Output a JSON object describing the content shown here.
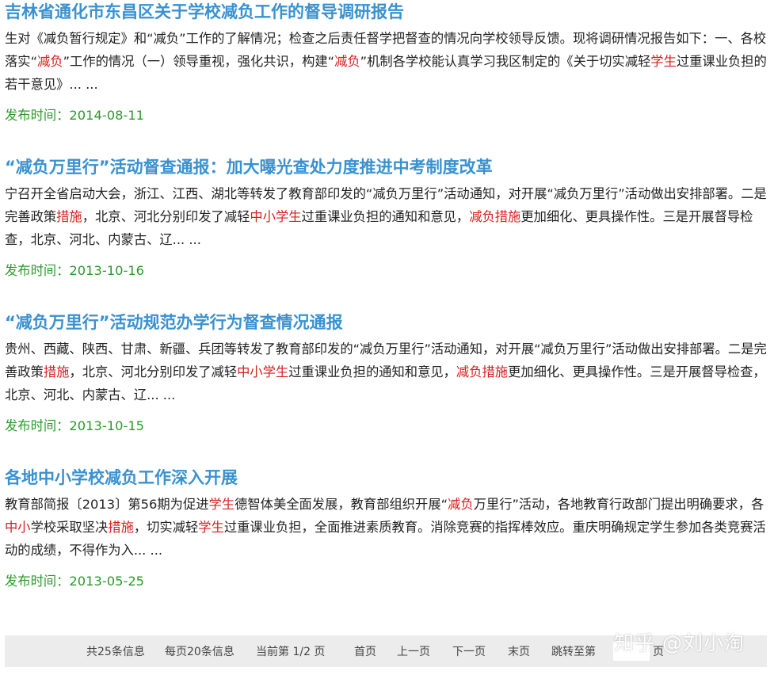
{
  "results": [
    {
      "title": "吉林省通化市东昌区关于学校减负工作的督导调研报告",
      "snippet": [
        {
          "t": "生对《减负暂行规定》和“减负”工作的了解情况；检查之后责任督学把督查的情况向学校领导反馈。现将调研情况报告如下：一、各校落实“"
        },
        {
          "t": "减负",
          "hl": true
        },
        {
          "t": "”工作的情况（一）领导重视，强化共识，构建“"
        },
        {
          "t": "减负",
          "hl": true
        },
        {
          "t": "”机制各学校能认真学习我区制定的《关于切实减轻"
        },
        {
          "t": "学生",
          "hl": true
        },
        {
          "t": "过重课业负担的若干意见》... ..."
        }
      ],
      "date_label": "发布时间：",
      "date": "2014-08-11"
    },
    {
      "title": "“减负万里行”活动督查通报：加大曝光查处力度推进中考制度改革",
      "snippet": [
        {
          "t": "宁召开全省启动大会，浙江、江西、湖北等转发了教育部印发的“减负万里行”活动通知，对开展“减负万里行”活动做出安排部署。二是完善政策"
        },
        {
          "t": "措施",
          "hl": true
        },
        {
          "t": "，北京、河北分别印发了减轻"
        },
        {
          "t": "中小学生",
          "hl": true
        },
        {
          "t": "过重课业负担的通知和意见，"
        },
        {
          "t": "减负措施",
          "hl": true
        },
        {
          "t": "更加细化、更具操作性。三是开展督导检查，北京、河北、内蒙古、辽... ..."
        }
      ],
      "date_label": "发布时间：",
      "date": "2013-10-16"
    },
    {
      "title": "“减负万里行”活动规范办学行为督查情况通报",
      "snippet": [
        {
          "t": "贵州、西藏、陕西、甘肃、新疆、兵团等转发了教育部印发的“减负万里行”活动通知，对开展“减负万里行”活动做出安排部署。二是完善政策"
        },
        {
          "t": "措施",
          "hl": true
        },
        {
          "t": "，北京、河北分别印发了减轻"
        },
        {
          "t": "中小学生",
          "hl": true
        },
        {
          "t": "过重课业负担的通知和意见，"
        },
        {
          "t": "减负措施",
          "hl": true
        },
        {
          "t": "更加细化、更具操作性。三是开展督导检查，北京、河北、内蒙古、辽... ..."
        }
      ],
      "date_label": "发布时间：",
      "date": "2013-10-15"
    },
    {
      "title": "各地中小学校减负工作深入开展",
      "snippet": [
        {
          "t": "教育部简报〔2013〕第56期为促进"
        },
        {
          "t": "学生",
          "hl": true
        },
        {
          "t": "德智体美全面发展，教育部组织开展“"
        },
        {
          "t": "减负",
          "hl": true
        },
        {
          "t": "万里行”活动，各地教育行政部门提出明确要求，各"
        },
        {
          "t": "中小",
          "hl": true
        },
        {
          "t": "学校采取坚决"
        },
        {
          "t": "措施",
          "hl": true
        },
        {
          "t": "，切实减轻"
        },
        {
          "t": "学生",
          "hl": true
        },
        {
          "t": "过重课业负担，全面推进素质教育。消除竞赛的指挥棒效应。重庆明确规定学生参加各类竞赛活动的成绩，不得作为入... ..."
        }
      ],
      "date_label": "发布时间：",
      "date": "2013-05-25"
    }
  ],
  "pagination": {
    "total": "共25条信息",
    "per_page": "每页20条信息",
    "current": "当前第 1/2 页",
    "first": "首页",
    "prev": "上一页",
    "next": "下一页",
    "last": "末页",
    "jump_label": "跳转至第",
    "page_unit": "页"
  },
  "watermark": "知乎 @刘小淘",
  "colors": {
    "title": "#3a91d0",
    "highlight": "#d71e1e",
    "date": "#2a9a2a",
    "text": "#222222",
    "pager_bg": "#ececec"
  }
}
